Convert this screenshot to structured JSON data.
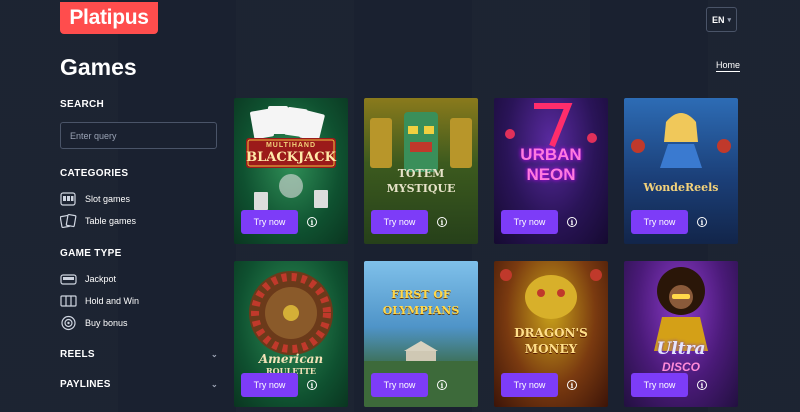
{
  "brand": {
    "logo_text": "Platipus",
    "accent": "#ff4d4d"
  },
  "header": {
    "language": "EN"
  },
  "page": {
    "title": "Games",
    "breadcrumb": "Home"
  },
  "sidebar": {
    "search": {
      "title": "SEARCH",
      "placeholder": "Enter query"
    },
    "categories": {
      "title": "CATEGORIES",
      "items": [
        {
          "label": "Slot games",
          "icon": "slot-machine-icon"
        },
        {
          "label": "Table games",
          "icon": "playing-cards-icon"
        }
      ]
    },
    "game_type": {
      "title": "GAME TYPE",
      "items": [
        {
          "label": "Jackpot",
          "icon": "jackpot-icon"
        },
        {
          "label": "Hold and Win",
          "icon": "reels-icon"
        },
        {
          "label": "Buy bonus",
          "icon": "target-icon"
        }
      ]
    },
    "reels": {
      "title": "REELS"
    },
    "paylines": {
      "title": "PAYLINES"
    }
  },
  "games": {
    "button_label": "Try now",
    "info_label": "i",
    "items": [
      {
        "name_line1": "MULTIHAND",
        "name_line2": "BLACKJACK"
      },
      {
        "name_line1": "TOTEM",
        "name_line2": "MYSTIQUE"
      },
      {
        "name_line1": "URBAN",
        "name_line2": "NEON"
      },
      {
        "name_line1": "WondeReels",
        "name_line2": ""
      },
      {
        "name_line1": "American",
        "name_line2": "ROULETTE"
      },
      {
        "name_line1": "FIRST OF",
        "name_line2": "OLYMPIANS"
      },
      {
        "name_line1": "DRAGON'S",
        "name_line2": "MONEY"
      },
      {
        "name_line1": "Ultra",
        "name_line2": "DISCO"
      }
    ]
  },
  "colors": {
    "background": "#1a2130",
    "button": "#7d3cf8"
  }
}
